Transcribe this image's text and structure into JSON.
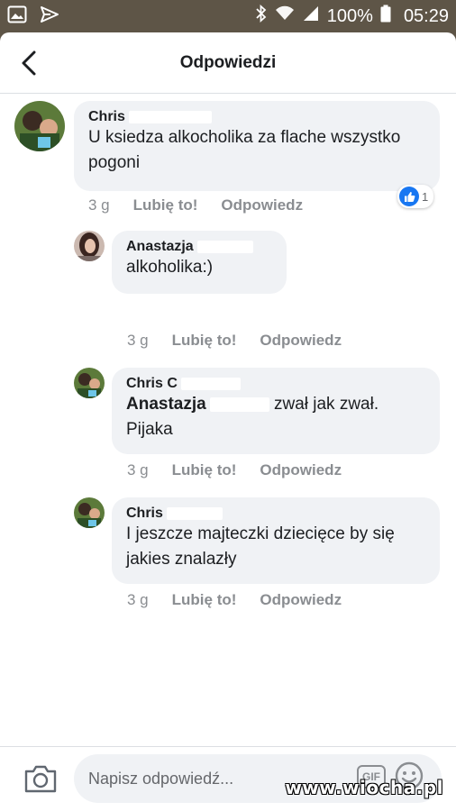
{
  "status_bar": {
    "battery": "100%",
    "time": "05:29"
  },
  "header": {
    "title": "Odpowiedzi"
  },
  "comments": [
    {
      "author": "Chris",
      "text": "U ksiedza alkocholika za flache wszystko pogoni",
      "time": "3 g",
      "like_label": "Lubię to!",
      "reply_label": "Odpowiedz",
      "reaction_count": "1"
    },
    {
      "author": "Anastazja",
      "text": "alkoholika:)",
      "time": "3 g",
      "like_label": "Lubię to!",
      "reply_label": "Odpowiedz"
    },
    {
      "author": "Chris C",
      "mention": "Anastazja",
      "text_after_mention": "zwał jak zwał. Pijaka",
      "time": "3 g",
      "like_label": "Lubię to!",
      "reply_label": "Odpowiedz"
    },
    {
      "author": "Chris",
      "text": "I jeszcze majteczki dziecięce by się jakies znalazły",
      "time": "3 g",
      "like_label": "Lubię to!",
      "reply_label": "Odpowiedz"
    }
  ],
  "composer": {
    "placeholder": "Napisz odpowiedź...",
    "gif_label": "GIF"
  },
  "watermark": "www.wiocha.pl",
  "colors": {
    "accent": "#1877f2",
    "bubble": "#f0f2f5",
    "meta_text": "#8a8d91",
    "status_bar": "#5e5547"
  }
}
